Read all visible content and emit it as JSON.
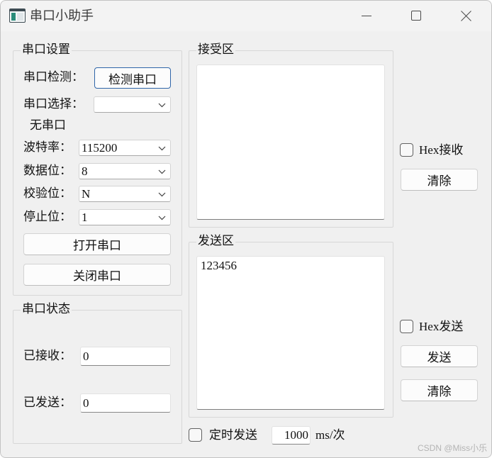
{
  "window": {
    "title": "串口小助手"
  },
  "icons": {
    "app": "app-window-icon",
    "minimize": "minimize-icon",
    "maximize": "maximize-icon",
    "close": "close-icon",
    "dropdown": "chevron-down-icon",
    "checkbox": "checkbox-icon"
  },
  "settings": {
    "title": "串口设置",
    "detect": {
      "label": "串口检测：",
      "button": "检测串口"
    },
    "port_select": {
      "label": "串口选择：",
      "value": ""
    },
    "port_status": "无串口",
    "baud_rate": {
      "label": "波特率：",
      "value": "115200"
    },
    "data_bits": {
      "label": "数据位：",
      "value": "8"
    },
    "parity": {
      "label": "校验位：",
      "value": "N"
    },
    "stop_bits": {
      "label": "停止位：",
      "value": "1"
    },
    "open_button": "打开串口",
    "close_button": "关闭串口"
  },
  "status": {
    "title": "串口状态",
    "received": {
      "label": "已接收：",
      "value": "0"
    },
    "sent": {
      "label": "已发送：",
      "value": "0"
    }
  },
  "receive_area": {
    "title": "接受区",
    "content": "",
    "hex_label": "Hex接收",
    "hex_checked": false,
    "clear_button": "清除"
  },
  "send_area": {
    "title": "发送区",
    "content": "123456",
    "hex_label": "Hex发送",
    "hex_checked": false,
    "send_button": "发送",
    "clear_button": "清除"
  },
  "timed_send": {
    "label": "定时发送",
    "checked": false,
    "interval": "1000",
    "unit": "ms/次"
  },
  "watermark": "CSDN @Miss小乐",
  "colors": {
    "window_bg": "#f0f0f0",
    "field_bg": "#ffffff",
    "default_button_border": "#2f65a8",
    "watermark": "#b4b4b4"
  }
}
